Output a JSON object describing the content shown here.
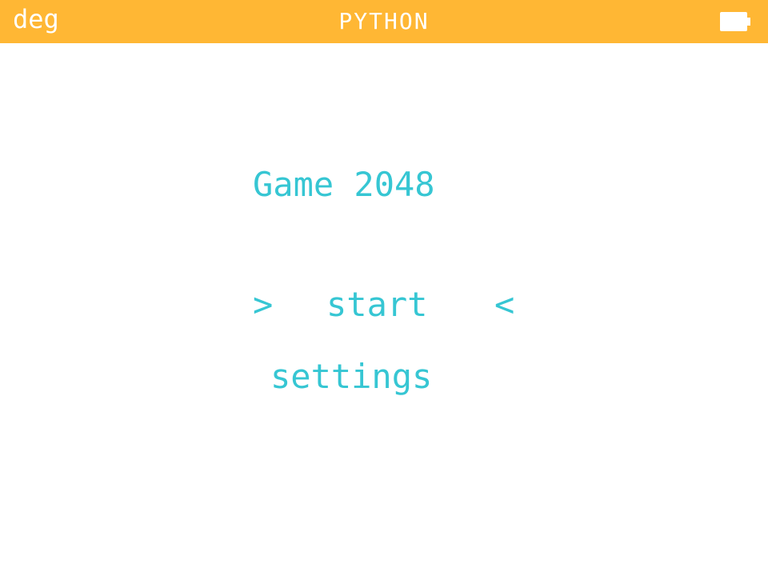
{
  "status_bar": {
    "angle_unit": "deg",
    "app_name": "PYTHON",
    "battery_icon": "battery-full-icon",
    "background_color": "#ffb734",
    "text_color": "#ffffff"
  },
  "game": {
    "title": "Game 2048",
    "text_color": "#36c6d3",
    "menu": {
      "selected_left_marker": ">",
      "selected_right_marker": "<",
      "items": [
        {
          "label": "start",
          "selected": true
        },
        {
          "label": "settings",
          "selected": false
        }
      ]
    }
  }
}
